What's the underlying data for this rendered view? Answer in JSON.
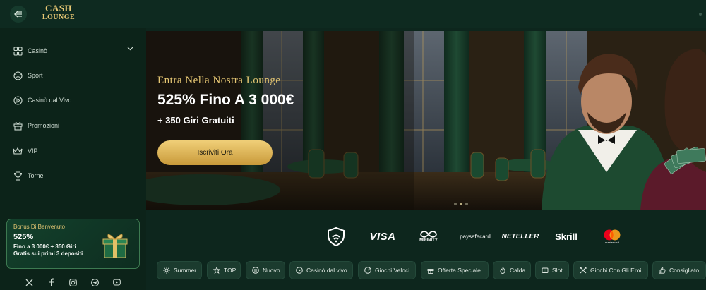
{
  "header": {
    "logo_line1": "CASH",
    "logo_line2": "LOUNGE",
    "collapse_icon": "sidebar-collapse-icon"
  },
  "sidebar": {
    "items": [
      {
        "label": "Casinò",
        "icon": "casino-icon",
        "has_dropdown": true
      },
      {
        "label": "Sport",
        "icon": "sport-ball-icon"
      },
      {
        "label": "Casinò dal Vivo",
        "icon": "live-play-icon"
      },
      {
        "label": "Promozioni",
        "icon": "gift-icon"
      },
      {
        "label": "VIP",
        "icon": "crown-icon"
      },
      {
        "label": "Tornei",
        "icon": "trophy-icon"
      }
    ],
    "bonus": {
      "title": "Bonus Di Benvenuto",
      "amount": "525%",
      "line1": "Fino a 3 000€ + 350 Giri",
      "line2": "Gratis sui primi 3 depositi"
    },
    "socials": [
      "x-icon",
      "facebook-icon",
      "instagram-icon",
      "telegram-icon",
      "youtube-icon"
    ]
  },
  "hero": {
    "eyebrow": "Entra Nella Nostra Lounge",
    "title": "525% Fino A 3 000€",
    "subtitle": "+ 350 Giri Gratuiti",
    "cta": "Iscriviti Ora",
    "slides": 3,
    "active_slide": 1
  },
  "payments": {
    "visa": "VISA",
    "mifinity": "MIFINITY",
    "paysafecard": "paysafecard",
    "neteller": "NETELLER",
    "skrill": "Skrill",
    "mastercard": "mastercard"
  },
  "categories": [
    {
      "label": "Summer",
      "icon": "sun-icon"
    },
    {
      "label": "TOP",
      "icon": "star-icon"
    },
    {
      "label": "Nuovo",
      "icon": "new-icon"
    },
    {
      "label": "Casinò dal vivo",
      "icon": "live-icon"
    },
    {
      "label": "Giochi Veloci",
      "icon": "speed-icon"
    },
    {
      "label": "Offerta Speciale",
      "icon": "gift-icon"
    },
    {
      "label": "Calda",
      "icon": "fire-icon"
    },
    {
      "label": "Slot",
      "icon": "slot-icon"
    },
    {
      "label": "Giochi Con Gli Eroi",
      "icon": "hero-icon"
    },
    {
      "label": "Consigliato",
      "icon": "thumbs-up-icon"
    }
  ],
  "colors": {
    "gold": "#e7c874",
    "background": "#0d261d",
    "sidebar": "#0c2319",
    "chip": "#1b3b2e"
  }
}
